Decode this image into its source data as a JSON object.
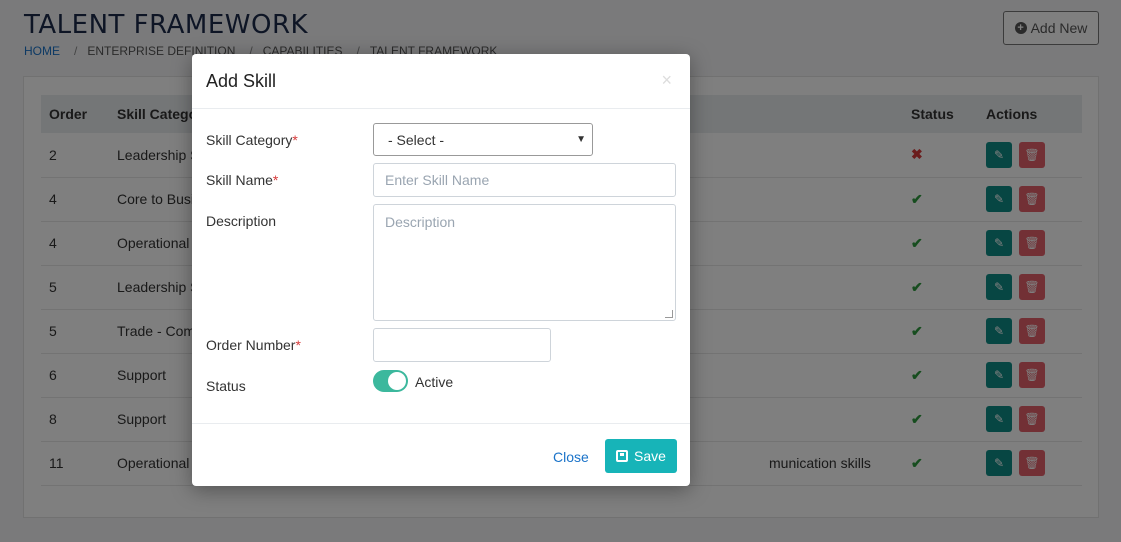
{
  "page": {
    "title": "TALENT FRAMEWORK",
    "add_new_label": "Add New",
    "breadcrumb": [
      "HOME",
      "ENTERPRISE DEFINITION",
      "CAPABILITIES",
      "TALENT FRAMEWORK"
    ]
  },
  "table": {
    "headers": [
      "Order",
      "Skill Category",
      "Status",
      "Actions"
    ],
    "rows": [
      {
        "order": "2",
        "category": "Leadership S",
        "description": "",
        "status": "inactive"
      },
      {
        "order": "4",
        "category": "Core to Busi",
        "description": "",
        "status": "active"
      },
      {
        "order": "4",
        "category": "Operational",
        "description": "",
        "status": "active"
      },
      {
        "order": "5",
        "category": "Leadership S",
        "description": "",
        "status": "active"
      },
      {
        "order": "5",
        "category": "Trade - Com",
        "description": "",
        "status": "active"
      },
      {
        "order": "6",
        "category": "Support",
        "description": "",
        "status": "active"
      },
      {
        "order": "8",
        "category": "Support",
        "description": "",
        "status": "active"
      },
      {
        "order": "11",
        "category": "Operational",
        "description": "munication skills",
        "status": "active"
      }
    ]
  },
  "modal": {
    "title": "Add Skill",
    "close_x": "×",
    "fields": {
      "skill_category_label": "Skill Category",
      "skill_category_value": "- Select -",
      "skill_name_label": "Skill Name",
      "skill_name_placeholder": "Enter Skill Name",
      "description_label": "Description",
      "description_placeholder": "Description",
      "order_number_label": "Order Number",
      "status_label": "Status",
      "status_toggle_label": "Active",
      "required_mark": "*"
    },
    "close_label": "Close",
    "save_label": "Save"
  },
  "colors": {
    "accent": "#17b4b8",
    "edit": "#0f8d87",
    "delete": "#e4606a",
    "toggle_on": "#3cb89d",
    "link": "#1a73c9"
  }
}
